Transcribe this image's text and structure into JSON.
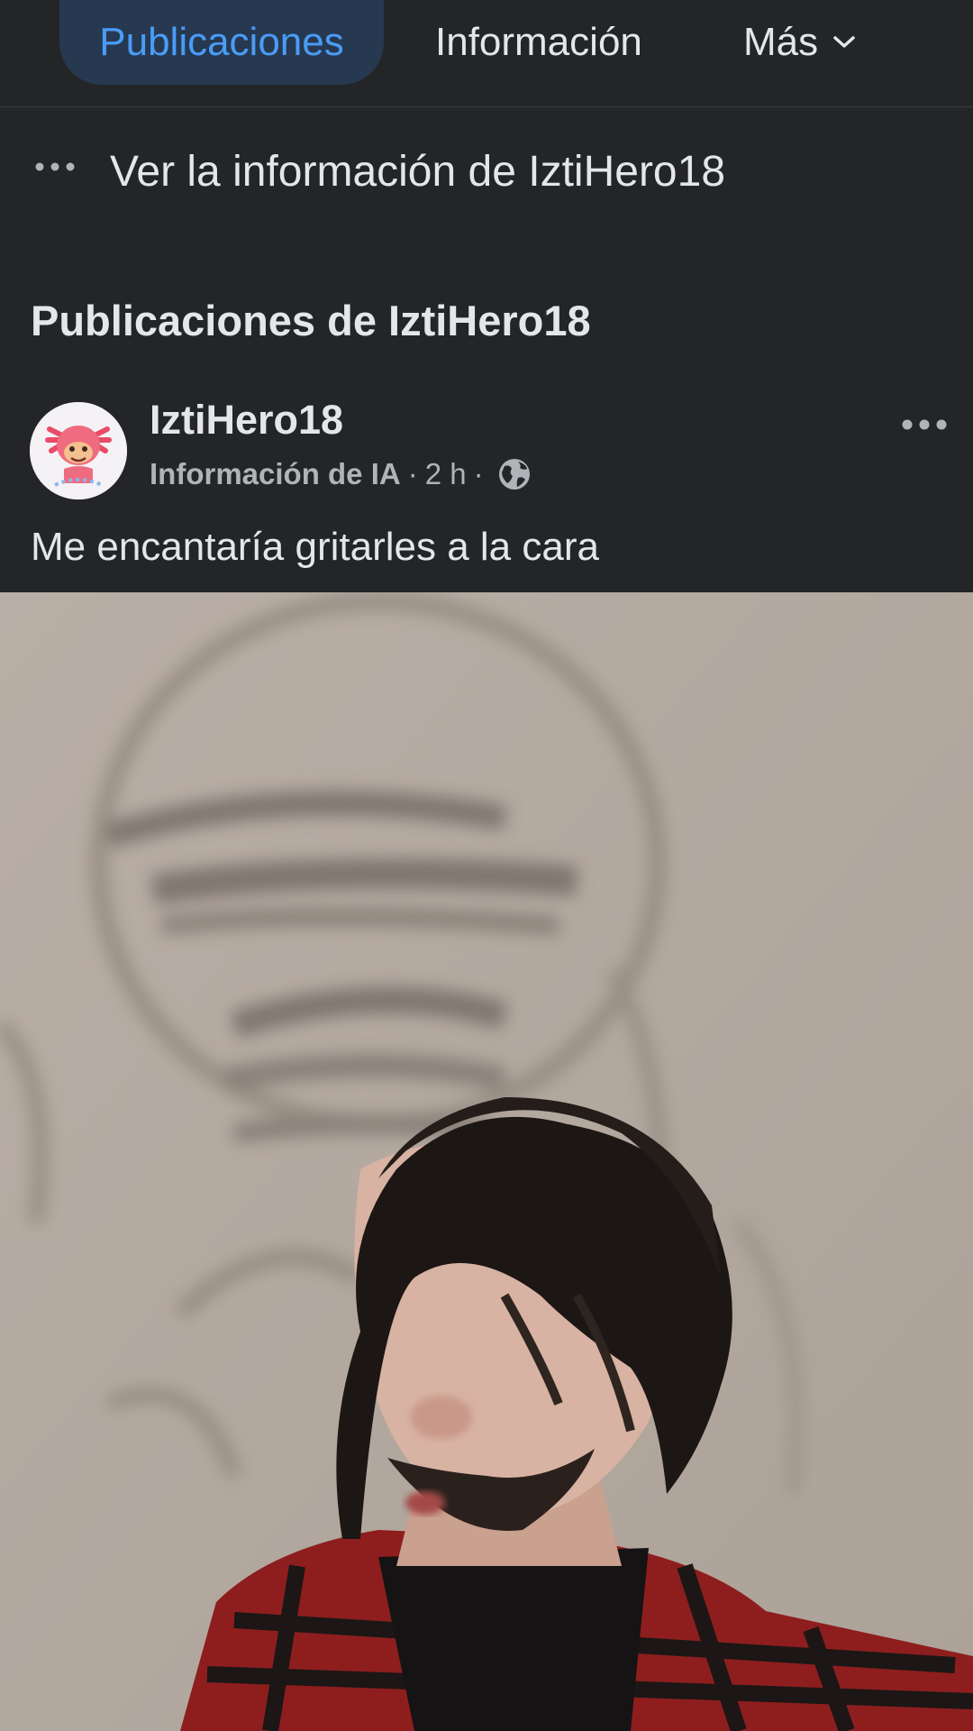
{
  "tabs": {
    "active": "Publicaciones",
    "info": "Información",
    "more": "Más"
  },
  "see_info": {
    "label": "Ver la información de IztiHero18",
    "icon": "more-dots-icon"
  },
  "section_title": "Publicaciones de IztiHero18",
  "post": {
    "author": "IztiHero18",
    "ai_label": "Información de IA",
    "sep1": "·",
    "time": "2 h",
    "sep2": "·",
    "privacy_icon": "globe-icon",
    "menu_icon": "more-dots-icon",
    "text": "Me encantaría gritarles a la cara"
  },
  "colors": {
    "background": "#242526",
    "accent": "#4a9cf6",
    "accent_bg": "#263951",
    "text": "#e4e6eb",
    "secondary_text": "#b0b3b8"
  }
}
